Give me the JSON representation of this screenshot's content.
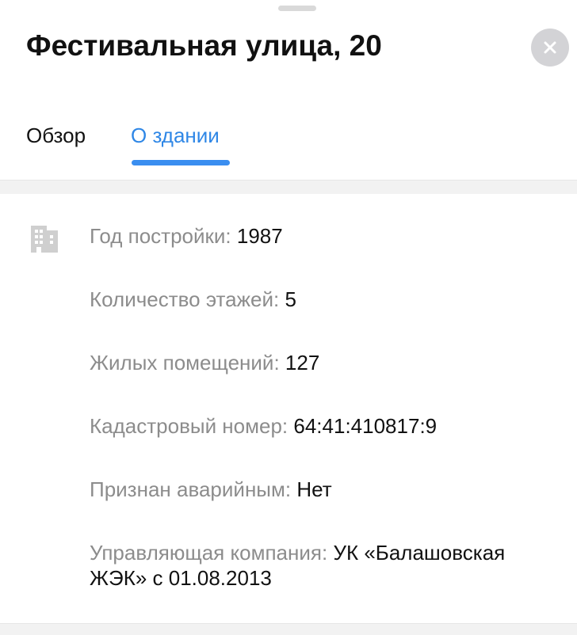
{
  "sheet": {
    "title": "Фестивальная улица, 20"
  },
  "tabs": [
    {
      "label": "Обзор",
      "active": false
    },
    {
      "label": "О здании",
      "active": true
    }
  ],
  "icons": {
    "close": "close-icon",
    "building": "building-icon"
  },
  "colors": {
    "accent": "#2f87e6",
    "label_gray": "#8c8c8c",
    "close_bg": "#d3d3d6"
  },
  "building_info": [
    {
      "label": "Год постройки:",
      "value": "1987"
    },
    {
      "label": "Количество этажей:",
      "value": "5"
    },
    {
      "label": "Жилых помещений:",
      "value": "127"
    },
    {
      "label": "Кадастровый номер:",
      "value": "64:41:410817:9"
    },
    {
      "label": "Признан аварийным:",
      "value": "Нет"
    },
    {
      "label": "Управляющая компания:",
      "value": "УК «Балашовская ЖЭК» с 01.08.2013"
    }
  ]
}
